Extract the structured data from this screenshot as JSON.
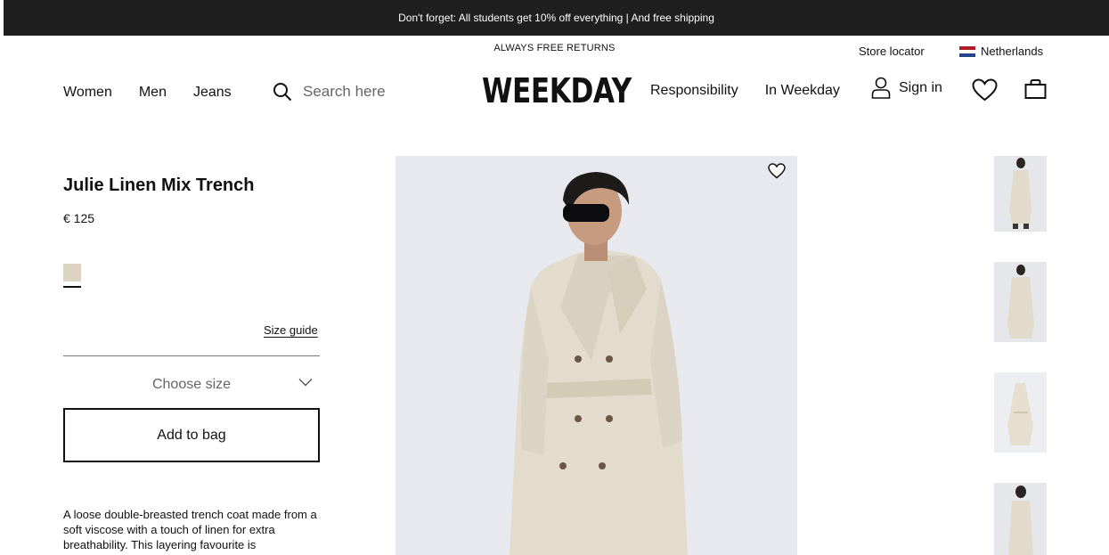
{
  "promo": {
    "text": "Don't forget: All students get 10% off everything | And free shipping"
  },
  "header": {
    "free_returns": "ALWAYS FREE RETURNS",
    "store_locator": "Store locator",
    "country": "Netherlands",
    "logo": "WEEKDAY",
    "nav_left": [
      "Women",
      "Men",
      "Jeans"
    ],
    "search_placeholder": "Search here",
    "nav_right": [
      "Responsibility",
      "In Weekday"
    ],
    "sign_in": "Sign in"
  },
  "product": {
    "title": "Julie Linen Mix Trench",
    "price": "€ 125",
    "swatch_color": "#dcd3c3",
    "size_guide": "Size guide",
    "choose_size": "Choose size",
    "add_to_bag": "Add to bag",
    "description": "A loose double-breasted trench coat made from a soft viscose with a touch of linen for extra breathability. This layering favourite is"
  },
  "colors": {
    "promo_bg": "#1f1f1f",
    "image_bg": "#e7e9ee",
    "coat": "#e3dccd",
    "text": "#111111"
  },
  "icons": [
    "search-icon",
    "user-icon",
    "heart-icon",
    "bag-icon",
    "chevron-down-icon",
    "flag-nl-icon"
  ]
}
